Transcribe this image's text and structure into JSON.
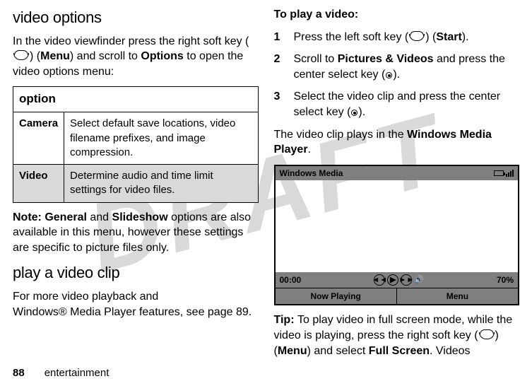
{
  "watermark": "DRAFT",
  "left": {
    "heading1": "video options",
    "intro_pre": "In the video viewfinder press the right soft key (",
    "intro_mid": ") (",
    "intro_menu": "Menu",
    "intro_post1": ") and scroll to ",
    "intro_options": "Options",
    "intro_post2": " to open the video options menu:",
    "table_header": "option",
    "row1_label": "Camera",
    "row1_text": "Select default save locations, video filename prefixes, and image compression.",
    "row2_label": "Video",
    "row2_text": "Determine audio and time limit settings for video files.",
    "note_label": "Note: ",
    "note_general": "General",
    "note_mid1": " and ",
    "note_slideshow": "Slideshow",
    "note_tail": " options are also available in this menu, however these settings are specific to picture files only.",
    "heading2": "play a video clip",
    "body2_line1": "For more video playback and",
    "body2_line2": "Windows® Media Player features, see page 89."
  },
  "right": {
    "heading": "To play a video:",
    "step1_pre": "Press the left soft key (",
    "step1_mid": ") (",
    "step1_start": "Start",
    "step1_post": ").",
    "step2_pre": "Scroll to ",
    "step2_pv": "Pictures & Videos",
    "step2_mid": " and press the center select key (",
    "step2_post": ").",
    "step3_pre": "Select the video clip and press the center select key (",
    "step3_post": ").",
    "plays_pre": "The video clip plays in the ",
    "plays_wmp": "Windows Media Player",
    "plays_post": ".",
    "player_title": "Windows Media",
    "time": "00:00",
    "volume": "70%",
    "soft_left": "Now Playing",
    "soft_right": "Menu",
    "tip_label": "Tip: ",
    "tip_pre": "To play video in full screen mode, while the video is playing, press the right soft key (",
    "tip_mid": ") (",
    "tip_menu": "Menu",
    "tip_mid2": ") and select ",
    "tip_fs": "Full Screen",
    "tip_post": ". Videos"
  },
  "footer": {
    "page": "88",
    "section": "entertainment"
  }
}
